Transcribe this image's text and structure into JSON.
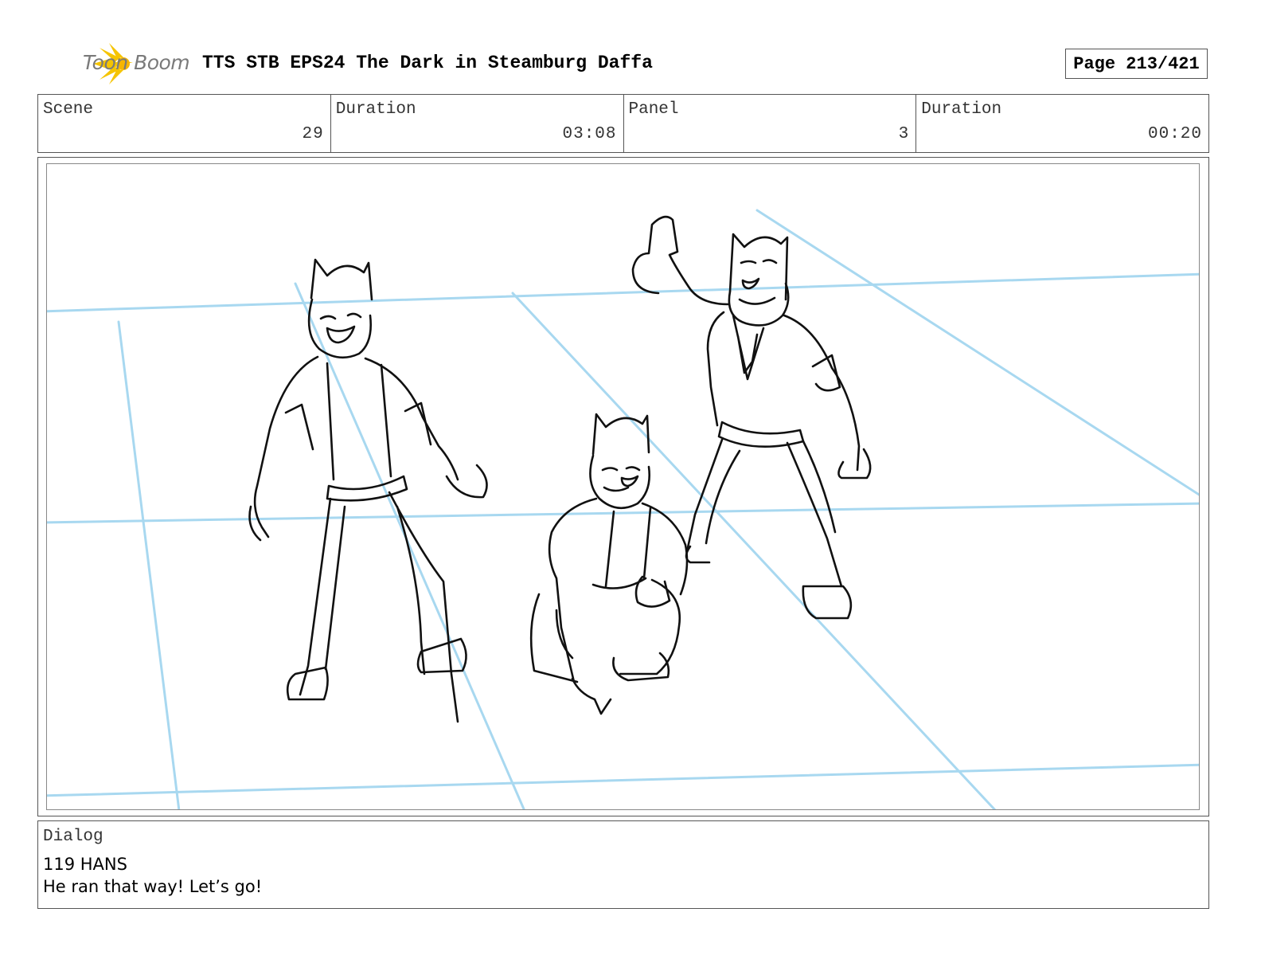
{
  "header": {
    "logo_text": "Toon Boom",
    "title": "TTS STB EPS24 The Dark in Steamburg Daffa",
    "page_label": "Page 213/421"
  },
  "info": {
    "scene_label": "Scene",
    "scene_value": "29",
    "scene_duration_label": "Duration",
    "scene_duration_value": "03:08",
    "panel_label": "Panel",
    "panel_value": "3",
    "panel_duration_label": "Duration",
    "panel_duration_value": "00:20"
  },
  "panel_image": {
    "description_icon": "storyboard-sketch",
    "guide_color": "#a8d8f0"
  },
  "dialog": {
    "label": "Dialog",
    "line1": "119 HANS",
    "line2": "He ran that way! Let’s go!"
  },
  "colors": {
    "logo_accent": "#f5c400",
    "border": "#555555"
  }
}
